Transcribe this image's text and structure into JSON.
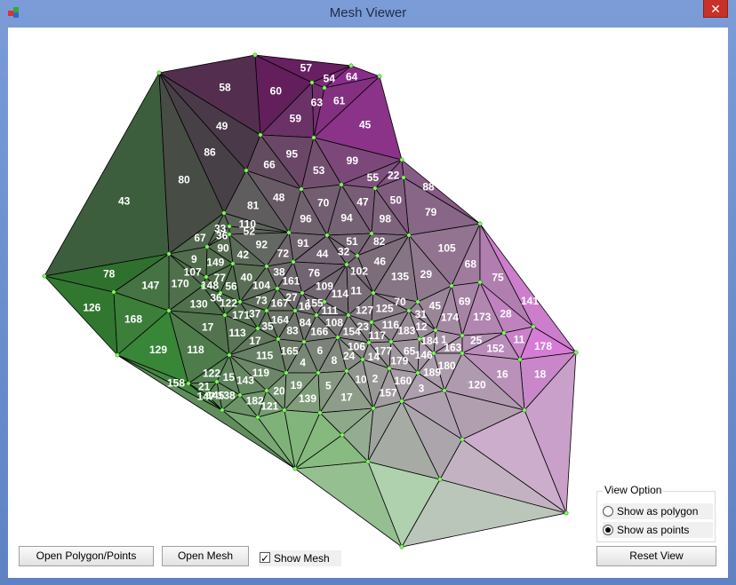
{
  "window": {
    "title": "Mesh Viewer",
    "close_label": "✕"
  },
  "toolbar": {
    "open_polygon_label": "Open Polygon/Points",
    "open_mesh_label": "Open Mesh",
    "show_mesh_label": "Show Mesh",
    "show_mesh_checked": true,
    "reset_view_label": "Reset View"
  },
  "view_option": {
    "title": "View Option",
    "options": [
      {
        "label": "Show as polygon",
        "selected": false
      },
      {
        "label": "Show as points",
        "selected": true
      }
    ]
  },
  "mesh": {
    "vertex_color": "#7dff5a",
    "edge_color": "#000000",
    "label_color": "#ffffff",
    "labels": [
      "57",
      "64",
      "54",
      "58",
      "60",
      "61",
      "63",
      "59",
      "45",
      "49",
      "86",
      "95",
      "99",
      "66",
      "53",
      "22",
      "55",
      "80",
      "88",
      "48",
      "50",
      "43",
      "47",
      "70",
      "81",
      "79",
      "94",
      "96",
      "98",
      "110",
      "33",
      "52",
      "36",
      "67",
      "51",
      "82",
      "91",
      "92",
      "90",
      "105",
      "32",
      "72",
      "44",
      "42",
      "9",
      "46",
      "149",
      "68",
      "102",
      "107",
      "38",
      "76",
      "78",
      "29",
      "135",
      "40",
      "75",
      "77",
      "161",
      "170",
      "148",
      "147",
      "104",
      "56",
      "109",
      "11",
      "114",
      "27",
      "36",
      "73",
      "141",
      "69",
      "70",
      "122",
      "167",
      "155",
      "130",
      "45",
      "10",
      "126",
      "125",
      "127",
      "111",
      "37",
      "28",
      "31",
      "171",
      "173",
      "174",
      "168",
      "164",
      "84",
      "108",
      "116",
      "35",
      "23",
      "12",
      "17",
      "83",
      "183",
      "166",
      "154",
      "113",
      "117",
      "1",
      "11",
      "25",
      "17",
      "184",
      "178",
      "106",
      "163",
      "152",
      "129",
      "118",
      "6",
      "177",
      "165",
      "65",
      "146",
      "115",
      "24",
      "14",
      "8",
      "179",
      "4",
      "180",
      "189",
      "119",
      "122",
      "18",
      "16",
      "15",
      "2",
      "10",
      "143",
      "160",
      "158",
      "120",
      "19",
      "5",
      "21",
      "3",
      "20",
      "157",
      "145",
      "138",
      "147",
      "17",
      "139",
      "182",
      "121"
    ]
  }
}
